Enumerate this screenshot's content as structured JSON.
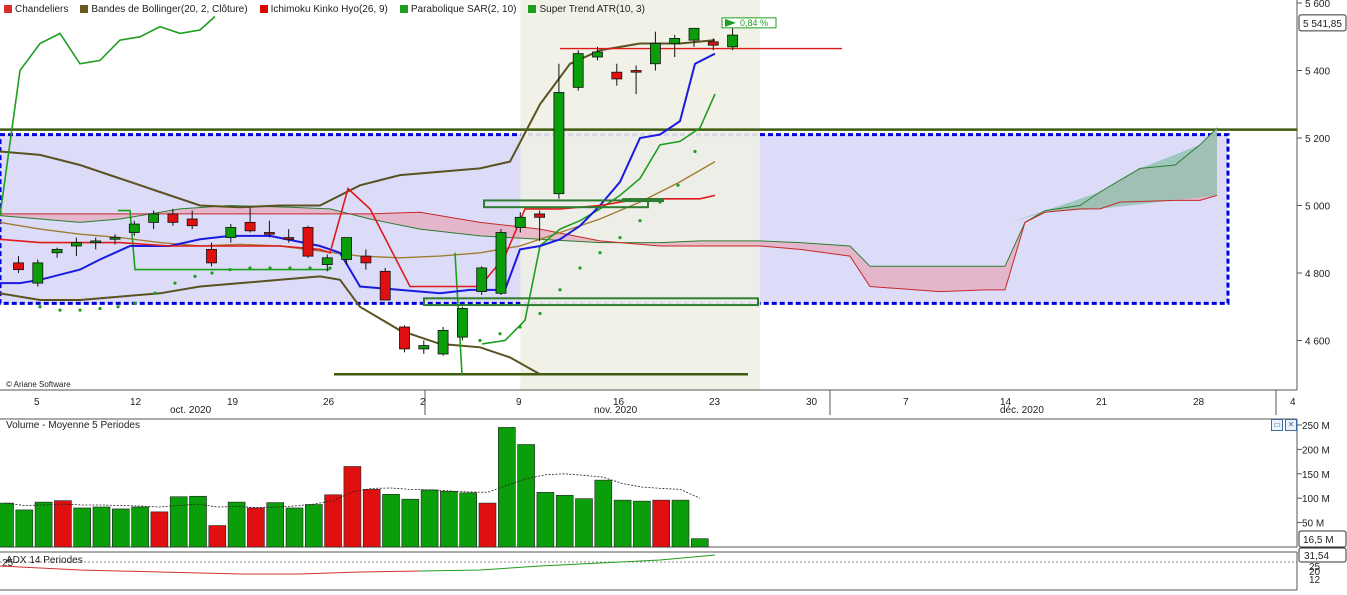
{
  "legend": [
    {
      "label": "Chandeliers",
      "color": "#d32f2f"
    },
    {
      "label": "Bandes de Bollinger(20, 2, Clôture)",
      "color": "#6b5a1e"
    },
    {
      "label": "Ichimoku Kinko Hyo(26, 9)",
      "color": "#e00000"
    },
    {
      "label": "Parabolique SAR(2, 10)",
      "color": "#1e9e1e"
    },
    {
      "label": "Super Trend ATR(10, 3)",
      "color": "#1e9e1e"
    }
  ],
  "copyright": "© Ariane Software",
  "last_price_badge": "5 541,85",
  "pct_change": "0,84 %",
  "volume_legend": "Volume  - Moyenne 5 Periodes",
  "volume_last_badge": "16,5 M",
  "adx_legend": "ADX 14 Periodes",
  "adx_last_badge": "31,54",
  "vol_buttons": [
    "▭",
    "✕"
  ],
  "colors": {
    "up": "#0a9e0a",
    "down": "#e01010",
    "kumo_bull": "#8fc3b0",
    "kumo_bear": "#e6a9bd",
    "zone": "#dcdcf8",
    "zone_border": "#0000dd"
  },
  "chart_data": {
    "type": "candlestick",
    "x_tick_labels": [
      "5",
      "12",
      "19",
      "26",
      "2",
      "9",
      "16",
      "23",
      "30",
      "7",
      "14",
      "21",
      "28",
      "4"
    ],
    "month_labels": [
      "oct. 2020",
      "nov. 2020",
      "déc. 2020"
    ],
    "y_tick_labels": [
      "5 600",
      "5 400",
      "5 200",
      "5 000",
      "4 800",
      "4 600"
    ],
    "ylim": [
      4500,
      5600
    ],
    "candles": [
      {
        "d": "2020-10-02",
        "o": 4830,
        "h": 4850,
        "l": 4800,
        "c": 4810
      },
      {
        "d": "2020-10-05",
        "o": 4770,
        "h": 4840,
        "l": 4760,
        "c": 4830
      },
      {
        "d": "2020-10-06",
        "o": 4860,
        "h": 4875,
        "l": 4845,
        "c": 4870
      },
      {
        "d": "2020-10-07",
        "o": 4880,
        "h": 4905,
        "l": 4850,
        "c": 4890
      },
      {
        "d": "2020-10-08",
        "o": 4890,
        "h": 4905,
        "l": 4870,
        "c": 4895
      },
      {
        "d": "2020-10-09",
        "o": 4900,
        "h": 4915,
        "l": 4885,
        "c": 4905
      },
      {
        "d": "2020-10-12",
        "o": 4920,
        "h": 4955,
        "l": 4910,
        "c": 4945
      },
      {
        "d": "2020-10-13",
        "o": 4950,
        "h": 4985,
        "l": 4930,
        "c": 4975
      },
      {
        "d": "2020-10-14",
        "o": 4975,
        "h": 4990,
        "l": 4940,
        "c": 4950
      },
      {
        "d": "2020-10-15",
        "o": 4960,
        "h": 4985,
        "l": 4930,
        "c": 4940
      },
      {
        "d": "2020-10-16",
        "o": 4870,
        "h": 4890,
        "l": 4820,
        "c": 4830
      },
      {
        "d": "2020-10-19",
        "o": 4905,
        "h": 4945,
        "l": 4890,
        "c": 4935
      },
      {
        "d": "2020-10-20",
        "o": 4950,
        "h": 4995,
        "l": 4920,
        "c": 4925
      },
      {
        "d": "2020-10-21",
        "o": 4920,
        "h": 4955,
        "l": 4905,
        "c": 4915
      },
      {
        "d": "2020-10-22",
        "o": 4905,
        "h": 4930,
        "l": 4890,
        "c": 4900
      },
      {
        "d": "2020-10-23",
        "o": 4935,
        "h": 4940,
        "l": 4845,
        "c": 4850
      },
      {
        "d": "2020-10-26",
        "o": 4825,
        "h": 4855,
        "l": 4805,
        "c": 4845
      },
      {
        "d": "2020-10-27",
        "o": 4840,
        "h": 4900,
        "l": 4825,
        "c": 4905
      },
      {
        "d": "2020-10-28",
        "o": 4850,
        "h": 4870,
        "l": 4810,
        "c": 4830
      },
      {
        "d": "2020-10-29",
        "o": 4805,
        "h": 4815,
        "l": 4720,
        "c": 4720
      },
      {
        "d": "2020-10-30",
        "o": 4640,
        "h": 4645,
        "l": 4565,
        "c": 4575
      },
      {
        "d": "2020-11-02",
        "o": 4575,
        "h": 4600,
        "l": 4560,
        "c": 4585
      },
      {
        "d": "2020-11-03",
        "o": 4560,
        "h": 4640,
        "l": 4555,
        "c": 4630
      },
      {
        "d": "2020-11-04",
        "o": 4610,
        "h": 4700,
        "l": 4600,
        "c": 4695
      },
      {
        "d": "2020-11-05",
        "o": 4745,
        "h": 4820,
        "l": 4735,
        "c": 4815
      },
      {
        "d": "2020-11-06",
        "o": 4740,
        "h": 4930,
        "l": 4735,
        "c": 4920
      },
      {
        "d": "2020-11-09",
        "o": 4935,
        "h": 4980,
        "l": 4920,
        "c": 4965
      },
      {
        "d": "2020-11-10",
        "o": 4975,
        "h": 4985,
        "l": 4895,
        "c": 4965
      },
      {
        "d": "2020-11-11",
        "o": 5035,
        "h": 5420,
        "l": 5020,
        "c": 5335
      },
      {
        "d": "2020-11-12",
        "o": 5350,
        "h": 5460,
        "l": 5340,
        "c": 5450
      },
      {
        "d": "2020-11-13",
        "o": 5440,
        "h": 5470,
        "l": 5430,
        "c": 5455
      },
      {
        "d": "2020-11-16",
        "o": 5395,
        "h": 5420,
        "l": 5355,
        "c": 5375
      },
      {
        "d": "2020-11-17",
        "o": 5400,
        "h": 5415,
        "l": 5330,
        "c": 5395
      },
      {
        "d": "2020-11-18",
        "o": 5420,
        "h": 5515,
        "l": 5400,
        "c": 5480
      },
      {
        "d": "2020-11-19",
        "o": 5480,
        "h": 5505,
        "l": 5440,
        "c": 5495
      },
      {
        "d": "2020-11-20",
        "o": 5490,
        "h": 5525,
        "l": 5470,
        "c": 5525
      },
      {
        "d": "2020-11-23",
        "o": 5485,
        "h": 5495,
        "l": 5460,
        "c": 5475
      },
      {
        "d": "2020-11-24",
        "o": 5470,
        "h": 5525,
        "l": 5460,
        "c": 5505
      },
      {
        "d": "2020-11-25",
        "o": 5541,
        "h": 5553,
        "l": 5535,
        "c": 5542
      }
    ],
    "volumes": [
      90,
      76,
      92,
      95,
      80,
      82,
      78,
      82,
      72,
      103,
      104,
      44,
      92,
      80,
      91,
      80,
      87,
      107,
      165,
      118,
      108,
      98,
      117,
      114,
      111,
      90,
      245,
      210,
      112,
      106,
      99,
      137,
      96,
      94,
      96,
      96,
      17
    ],
    "volume_avg": [
      90,
      85,
      86,
      88,
      86,
      86,
      85,
      84,
      82,
      85,
      88,
      82,
      83,
      81,
      82,
      84,
      88,
      95,
      113,
      120,
      121,
      118,
      117,
      115,
      113,
      112,
      126,
      140,
      148,
      150,
      147,
      143,
      130,
      123,
      120,
      118,
      100
    ],
    "volume_ylim": [
      0,
      260
    ],
    "volume_tick_labels": [
      "250 M",
      "200 M",
      "150 M",
      "100 M",
      "50 M"
    ],
    "adx_tick_labels": [
      "25",
      "20",
      "12"
    ]
  }
}
